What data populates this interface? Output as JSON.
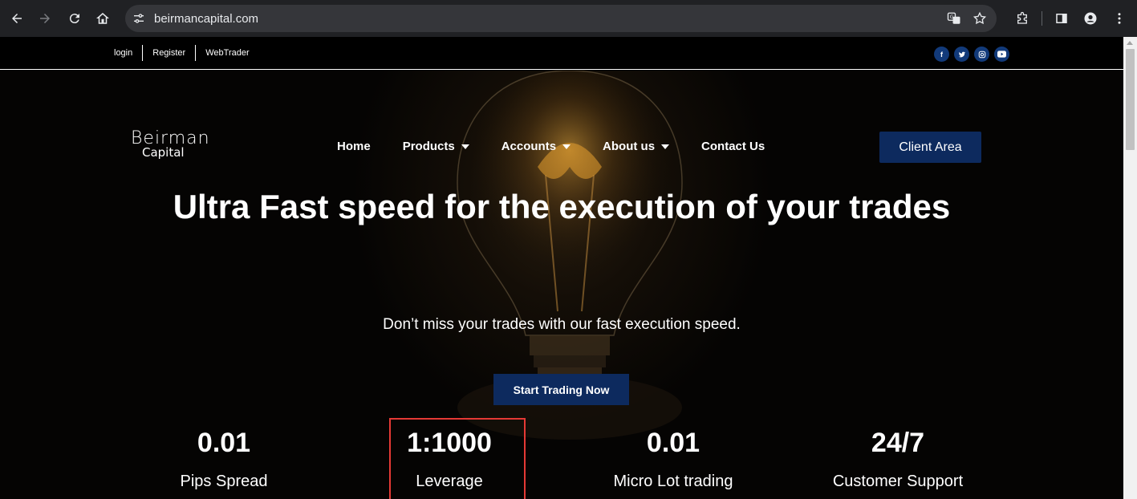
{
  "browser": {
    "url": "beirmancapital.com"
  },
  "topbar": {
    "links": [
      "login",
      "Register",
      "WebTrader"
    ],
    "socials": [
      "facebook-icon",
      "twitter-icon",
      "instagram-icon",
      "youtube-icon"
    ]
  },
  "logo": {
    "line1": "Beirman",
    "line2": "Capital"
  },
  "nav": {
    "items": [
      {
        "label": "Home",
        "dropdown": false
      },
      {
        "label": "Products",
        "dropdown": true
      },
      {
        "label": "Accounts",
        "dropdown": true
      },
      {
        "label": "About us",
        "dropdown": true
      },
      {
        "label": "Contact Us",
        "dropdown": false
      }
    ],
    "client_area": "Client Area"
  },
  "hero": {
    "headline": "Ultra Fast speed for the execution of your trades",
    "subline": "Don’t miss your trades with our fast execution speed.",
    "cta": "Start Trading Now"
  },
  "stats": [
    {
      "value": "0.01",
      "label": "Pips Spread"
    },
    {
      "value": "1:1000",
      "label": "Leverage"
    },
    {
      "value": "0.01",
      "label": "Micro Lot trading"
    },
    {
      "value": "24/7",
      "label": "Customer Support"
    }
  ],
  "colors": {
    "brand_blue": "#0d2a5e",
    "social_blue": "#123a7a",
    "highlight": "#e53935"
  }
}
